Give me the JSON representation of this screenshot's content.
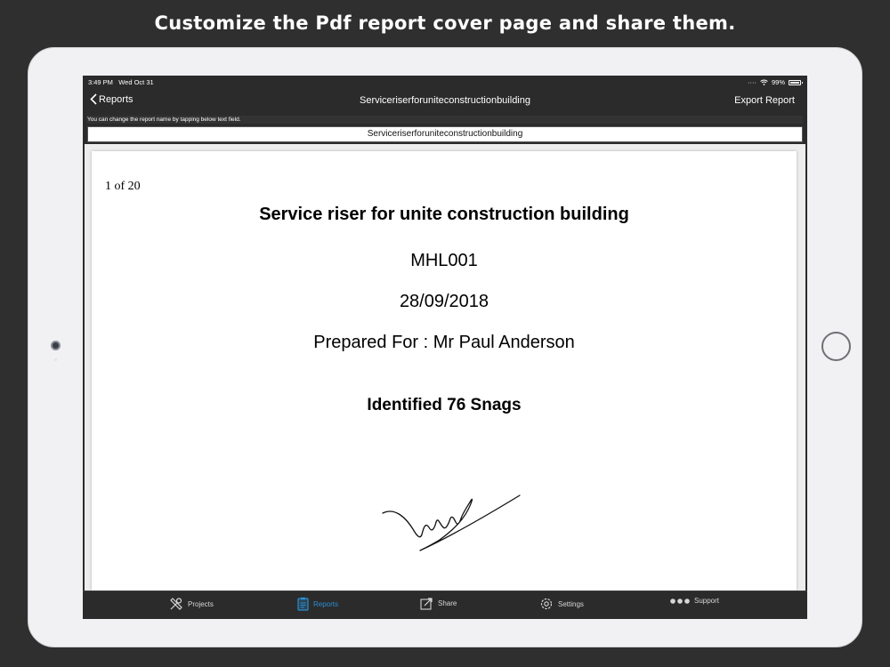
{
  "headline": "Customize the Pdf report cover page and share them.",
  "status_bar": {
    "time": "3:49 PM",
    "date": "Wed Oct 31",
    "battery": "99%",
    "battery_level": 0.99
  },
  "nav": {
    "back_label": "Reports",
    "title": "Serviceriserforuniteconstructionbuilding",
    "export_label": "Export Report"
  },
  "hint_text": "You can change the report name by tapping below text field.",
  "report_name_value": "Serviceriserforuniteconstructionbuilding",
  "cover_page": {
    "page_counter": "1 of 20",
    "title": "Service riser for unite construction building",
    "code": "MHL001",
    "date": "28/09/2018",
    "prepared_for": "Prepared For : Mr Paul Anderson",
    "snags": "Identified 76 Snags"
  },
  "tabs": [
    {
      "label": "Projects",
      "icon": "tools-icon",
      "active": false
    },
    {
      "label": "Reports",
      "icon": "clipboard-icon",
      "active": true
    },
    {
      "label": "Share",
      "icon": "share-icon",
      "active": false
    },
    {
      "label": "Settings",
      "icon": "gear-icon",
      "active": false
    },
    {
      "label": "Support",
      "icon": "more-dots-icon",
      "active": false
    }
  ],
  "colors": {
    "accent": "#2a8fd4",
    "background": "#2f2f2f",
    "device_frame": "#f1f1f3",
    "app_dark": "#2b2b2b"
  }
}
